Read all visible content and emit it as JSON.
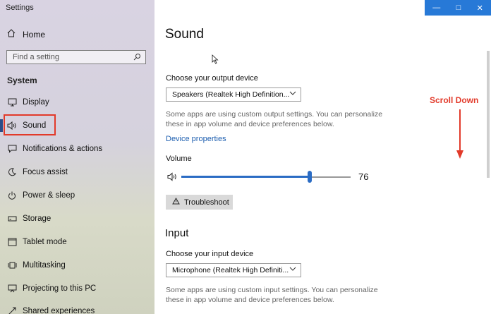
{
  "window": {
    "title": "Settings"
  },
  "sidebar": {
    "home_label": "Home",
    "search_placeholder": "Find a setting",
    "section_label": "System",
    "items": [
      {
        "label": "Display",
        "icon": "display-icon"
      },
      {
        "label": "Sound",
        "icon": "speaker-icon",
        "active": true
      },
      {
        "label": "Notifications & actions",
        "icon": "notification-icon"
      },
      {
        "label": "Focus assist",
        "icon": "moon-icon"
      },
      {
        "label": "Power & sleep",
        "icon": "power-icon"
      },
      {
        "label": "Storage",
        "icon": "storage-icon"
      },
      {
        "label": "Tablet mode",
        "icon": "tablet-icon"
      },
      {
        "label": "Multitasking",
        "icon": "multitasking-icon"
      },
      {
        "label": "Projecting to this PC",
        "icon": "projector-icon"
      },
      {
        "label": "Shared experiences",
        "icon": "shared-icon"
      }
    ]
  },
  "main": {
    "title": "Sound",
    "output": {
      "label": "Choose your output device",
      "selected": "Speakers (Realtek High Definition...",
      "description": "Some apps are using custom output settings. You can personalize these in app volume and device preferences below.",
      "link": "Device properties"
    },
    "volume": {
      "label": "Volume",
      "value": 76
    },
    "troubleshoot_label": "Troubleshoot",
    "input": {
      "heading": "Input",
      "label": "Choose your input device",
      "selected": "Microphone (Realtek High Definiti...",
      "description": "Some apps are using custom input settings. You can personalize these in app volume and device preferences below."
    }
  },
  "annotation": {
    "text": "Scroll Down",
    "color": "#e23a2a"
  },
  "colors": {
    "accent": "#2b6cc4",
    "titlebar": "#2779d7",
    "highlight": "#e23a2a",
    "link": "#1e5fb0"
  }
}
